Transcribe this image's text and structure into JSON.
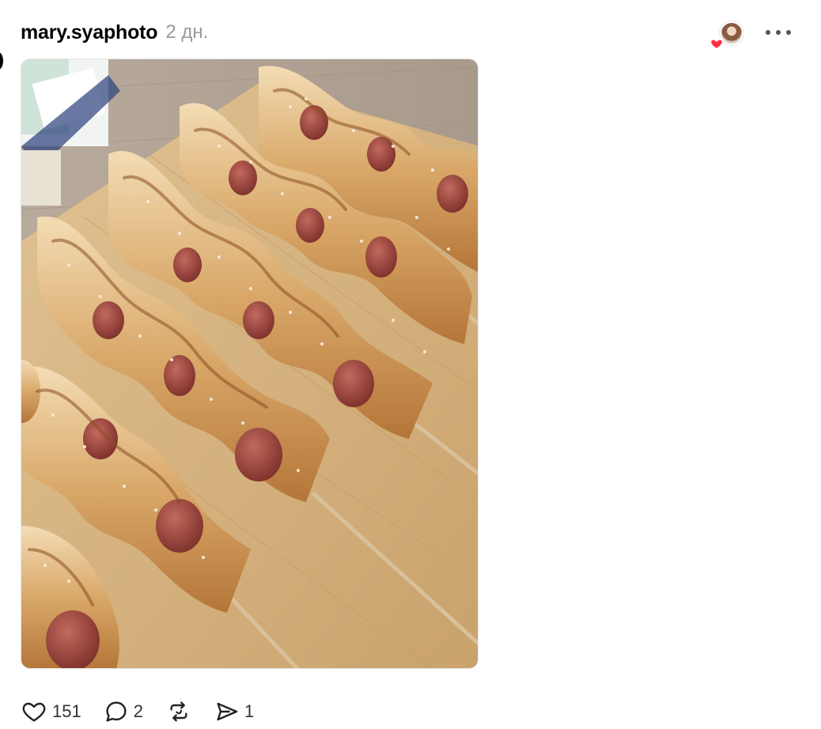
{
  "post": {
    "username": "mary.syaphoto",
    "time_ago": "2 дн.",
    "image_alt": "sausages-in-puff-pastry-on-skewers-photo"
  },
  "actions": {
    "likes": "151",
    "comments": "2",
    "shares": "1"
  },
  "icons": {
    "like": "heart-outline-icon",
    "comment": "speech-bubble-icon",
    "repost": "repost-arrows-icon",
    "share": "send-icon",
    "more": "more-horizontal-icon",
    "liked_badge": "heart-filled-icon"
  },
  "colors": {
    "heart_red": "#ff3040",
    "time_gray": "#9a9a9a",
    "icon_dark": "#222222"
  }
}
